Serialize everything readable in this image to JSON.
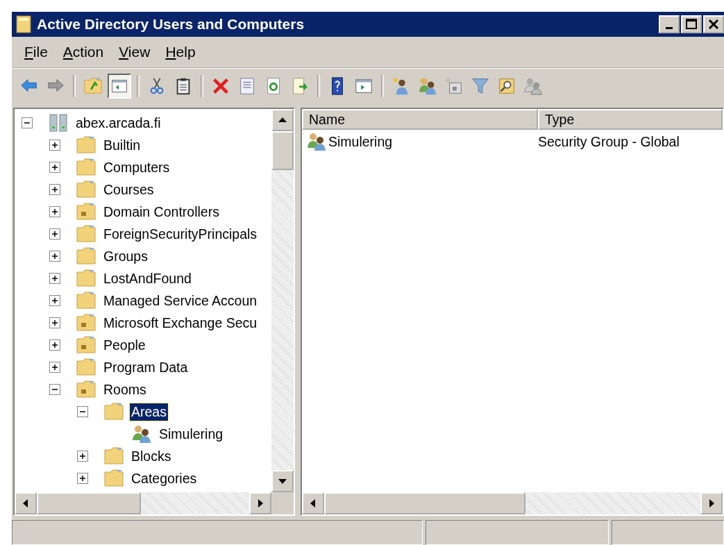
{
  "window": {
    "title": "Active Directory Users and Computers"
  },
  "menu": [
    "File",
    "Action",
    "View",
    "Help"
  ],
  "toolbar": [
    [
      {
        "kind": "back",
        "pressed": false
      },
      {
        "kind": "forward",
        "pressed": false
      }
    ],
    [
      {
        "kind": "up",
        "pressed": false
      },
      {
        "kind": "tree",
        "pressed": true
      }
    ],
    [
      {
        "kind": "cut",
        "pressed": false
      },
      {
        "kind": "paste",
        "pressed": false
      }
    ],
    [
      {
        "kind": "delete",
        "pressed": false
      },
      {
        "kind": "properties",
        "pressed": false
      },
      {
        "kind": "refresh",
        "pressed": false
      },
      {
        "kind": "export",
        "pressed": false
      }
    ],
    [
      {
        "kind": "help",
        "pressed": false
      },
      {
        "kind": "panel",
        "pressed": false
      }
    ],
    [
      {
        "kind": "newuser",
        "pressed": false
      },
      {
        "kind": "newgroup",
        "pressed": false
      },
      {
        "kind": "newou",
        "pressed": false
      },
      {
        "kind": "filter",
        "pressed": false
      },
      {
        "kind": "find",
        "pressed": false
      },
      {
        "kind": "addgroup",
        "pressed": false
      }
    ]
  ],
  "tree": [
    {
      "label": "abex.arcada.fi",
      "kind": "domain",
      "expanded": true,
      "selected": false,
      "children": [
        {
          "label": "Builtin",
          "kind": "folder",
          "expanded": false,
          "selected": false
        },
        {
          "label": "Computers",
          "kind": "folder",
          "expanded": false,
          "selected": false
        },
        {
          "label": "Courses",
          "kind": "folder",
          "expanded": false,
          "selected": false
        },
        {
          "label": "Domain Controllers",
          "kind": "ou",
          "expanded": false,
          "selected": false
        },
        {
          "label": "ForeignSecurityPrincipals",
          "kind": "folder",
          "expanded": false,
          "selected": false
        },
        {
          "label": "Groups",
          "kind": "folder",
          "expanded": false,
          "selected": false
        },
        {
          "label": "LostAndFound",
          "kind": "folder",
          "expanded": false,
          "selected": false
        },
        {
          "label": "Managed Service Accoun",
          "kind": "folder",
          "expanded": false,
          "selected": false
        },
        {
          "label": "Microsoft Exchange Secu",
          "kind": "ou",
          "expanded": false,
          "selected": false
        },
        {
          "label": "People",
          "kind": "ou",
          "expanded": false,
          "selected": false
        },
        {
          "label": "Program Data",
          "kind": "folder",
          "expanded": false,
          "selected": false
        },
        {
          "label": "Rooms",
          "kind": "ou",
          "expanded": true,
          "selected": false,
          "children": [
            {
              "label": "Areas",
              "kind": "folder",
              "expanded": true,
              "selected": true,
              "children": [
                {
                  "label": "Simulering",
                  "kind": "group",
                  "selected": false
                }
              ]
            },
            {
              "label": "Blocks",
              "kind": "folder",
              "expanded": false,
              "selected": false
            },
            {
              "label": "Categories",
              "kind": "folder",
              "expanded": false,
              "selected": false
            }
          ]
        }
      ]
    }
  ],
  "list": {
    "columns": [
      "Name",
      "Type"
    ],
    "rows": [
      {
        "kind": "group",
        "name": "Simulering",
        "type": "Security Group - Global"
      }
    ]
  }
}
